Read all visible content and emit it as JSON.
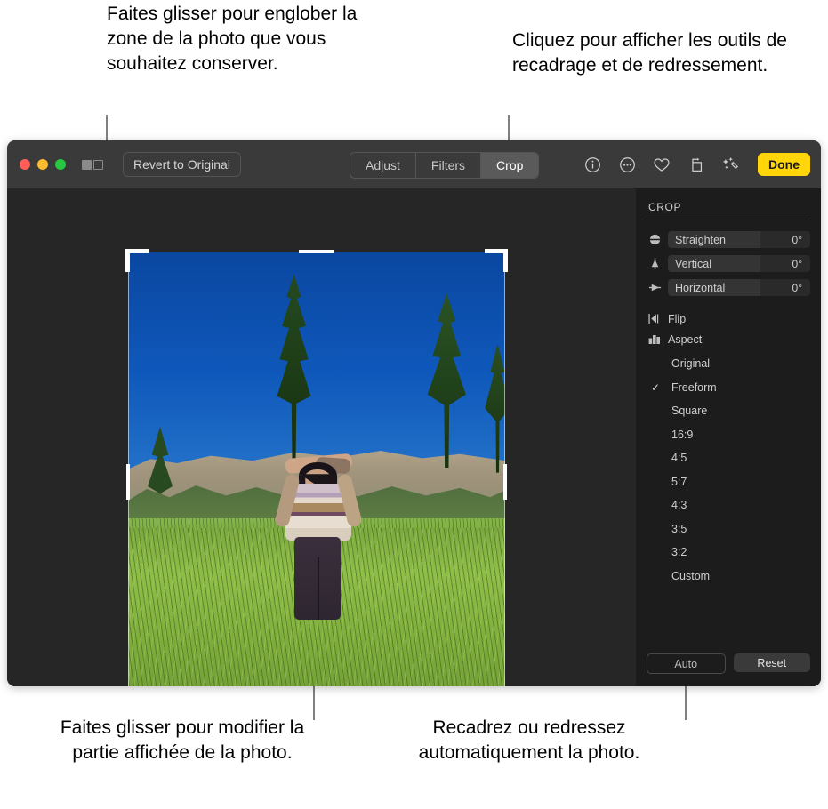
{
  "callouts": {
    "top_left": "Faites glisser pour englober la zone de la photo que vous souhaitez conserver.",
    "top_right": "Cliquez pour afficher les outils de recadrage et de redressement.",
    "bottom_left": "Faites glisser pour modifier la partie affichée de la photo.",
    "bottom_right": "Recadrez ou redressez automatiquement la photo."
  },
  "toolbar": {
    "revert_label": "Revert to Original",
    "segments": [
      {
        "label": "Adjust",
        "active": false
      },
      {
        "label": "Filters",
        "active": false
      },
      {
        "label": "Crop",
        "active": true
      }
    ],
    "icons": [
      "info-icon",
      "more-options-icon",
      "favorite-heart-icon",
      "rotate-icon",
      "auto-enhance-icon"
    ],
    "done_label": "Done",
    "done_color": "#ffd60a",
    "window_controls": [
      "close",
      "minimize",
      "zoom"
    ],
    "sidebar_toggle": "sidebar-toggle-icon"
  },
  "sidebar": {
    "section_title": "CROP",
    "sliders": [
      {
        "icon": "straighten-icon",
        "label": "Straighten",
        "value": "0°"
      },
      {
        "icon": "vertical-icon",
        "label": "Vertical",
        "value": "0°"
      },
      {
        "icon": "horizontal-icon",
        "label": "Horizontal",
        "value": "0°"
      }
    ],
    "menu_items": [
      {
        "icon": "flip-icon",
        "label": "Flip"
      },
      {
        "icon": "aspect-icon",
        "label": "Aspect"
      }
    ],
    "aspect_options": [
      {
        "label": "Original",
        "selected": false
      },
      {
        "label": "Freeform",
        "selected": true
      },
      {
        "label": "Square",
        "selected": false
      },
      {
        "label": "16:9",
        "selected": false
      },
      {
        "label": "4:5",
        "selected": false
      },
      {
        "label": "5:7",
        "selected": false
      },
      {
        "label": "4:3",
        "selected": false
      },
      {
        "label": "3:5",
        "selected": false
      },
      {
        "label": "3:2",
        "selected": false
      },
      {
        "label": "Custom",
        "selected": false
      }
    ],
    "check_glyph": "✓",
    "auto_label": "Auto",
    "reset_label": "Reset"
  }
}
